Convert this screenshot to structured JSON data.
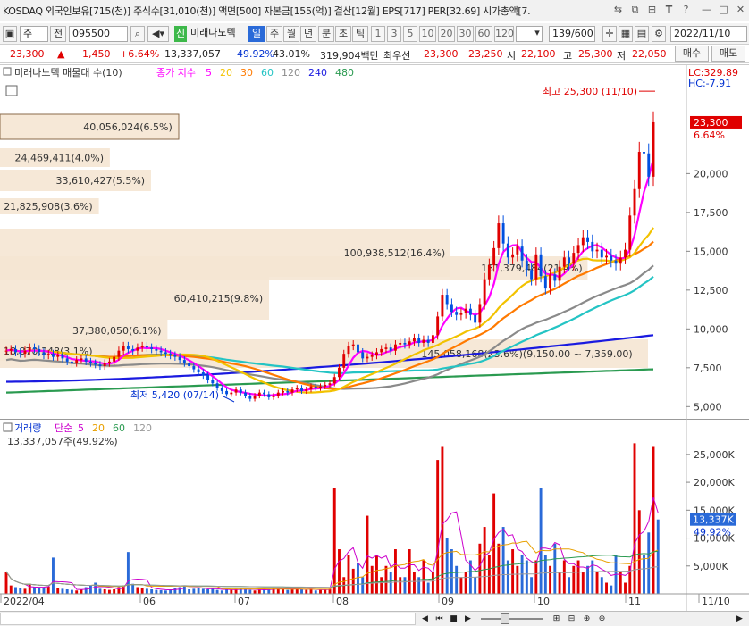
{
  "title_bar": {
    "text": "KOSDAQ 외국인보유[715(천)] 주식수[31,010(천)] 액면[500] 자본금[155(억)] 결산[12월] EPS[717] PER[32.69] 시가총액[7.",
    "icons": [
      "link-icon",
      "copy-icon",
      "pin-icon",
      "font-icon",
      "settings-icon",
      "help-icon",
      "minimize-icon",
      "maximize-icon",
      "close-icon"
    ],
    "glyphs": [
      "⇆",
      "⧉",
      "⊞",
      "T",
      "⚙",
      "?",
      "—",
      "□",
      "✕"
    ]
  },
  "toolbar": {
    "mode_select": "주",
    "jeon_label": "전",
    "stock_code": "095500",
    "stock_name": "미래나노텍",
    "shin_badge": "신",
    "periods": [
      "일",
      "주",
      "월",
      "년",
      "분",
      "초",
      "틱"
    ],
    "selected_period": "일",
    "intervals": [
      "1",
      "3",
      "5",
      "10",
      "20",
      "30",
      "60",
      "120"
    ],
    "bar_count": "139/600",
    "date": "2022/11/10"
  },
  "quote": {
    "price": "23,300",
    "arrow": "▲",
    "change": "1,450",
    "change_pct": "+6.64%",
    "volume": "13,337,057",
    "vol_ratio": "49.92%",
    "foreign_pct": "43.01%",
    "trade_value": "319,904백만",
    "limit_label": "최우선",
    "ask": "23,300",
    "bid": "23,250",
    "open_label": "시",
    "open": "22,100",
    "high_label": "고",
    "high": "25,300",
    "low_label": "저",
    "low": "22,050",
    "buy_button": "매수",
    "sell_button": "매도"
  },
  "price_panel": {
    "legend_name": "미래나노텍 매물대 수(10)",
    "ma_label": "종가 지수",
    "ma_periods": [
      "5",
      "20",
      "30",
      "60",
      "120",
      "240",
      "480"
    ],
    "ma_colors": [
      "#ff00ff",
      "#f2c200",
      "#ff7a00",
      "#24c4c4",
      "#8a8a8a",
      "#1a1ae0",
      "#2a9a50"
    ],
    "lc_label": "LC:329.89",
    "hc_label": "HC:-7.91",
    "current_price_tag": "23,300",
    "current_pct": "6.64%",
    "y_ticks": [
      "20,000",
      "17,500",
      "15,000",
      "12,500",
      "10,000",
      "7,500",
      "5,000"
    ],
    "max_label": "최고 25,300 (11/10)",
    "min_label": "최저 5,420 (07/14)",
    "volume_profile": [
      "40,056,024(6.5%)",
      "24,469,411(4.0%)",
      "33,610,427(5.5%)",
      "21,825,908(3.6%)",
      "100,938,512(16.4%)",
      "60,410,215(9.8%)",
      "37,380,050(6.1%)",
      "18,870,348(3.1%)",
      "131,379,484(21.4%)",
      "145,058,168(23.6%)(9,150.00 ~ 7,359.00)"
    ],
    "volume_profile_pct": [
      6.5,
      4.0,
      5.5,
      3.6,
      16.4,
      9.8,
      6.1,
      3.1,
      21.4,
      23.6
    ]
  },
  "volume_panel": {
    "label": "거래량",
    "ma_label": "단순",
    "ma_periods": [
      "5",
      "20",
      "60",
      "120"
    ],
    "ma_colors": [
      "#cc00cc",
      "#e8a000",
      "#2a9a50",
      "#9a9a9a"
    ],
    "info": "13,337,057주(49.92%)",
    "current_tag": "13,337K",
    "current_pct": "49.92%",
    "y_ticks": [
      "25,000K",
      "20,000K",
      "15,000K",
      "10,000K",
      "5,000K"
    ]
  },
  "x_axis": {
    "labels": [
      "2022/04",
      "06",
      "07",
      "08",
      "09",
      "10",
      "11",
      "11/10"
    ]
  },
  "bottom_bar": {
    "buttons": [
      "◀",
      "⏮",
      "■",
      "▶",
      "▷",
      "⊞",
      "⊟",
      "⊕",
      "⊖",
      "▶"
    ]
  },
  "chart_data": {
    "type": "candlestick",
    "period": "daily",
    "x_range": [
      "2022-04",
      "2022-11-10"
    ],
    "y_range": [
      4500,
      26000
    ],
    "close_series": [
      8600,
      8700,
      8500,
      8400,
      8600,
      8800,
      8700,
      8500,
      8300,
      8400,
      8200,
      8300,
      8100,
      7900,
      7800,
      8000,
      8100,
      7900,
      7800,
      7700,
      7600,
      7800,
      7900,
      8200,
      8600,
      8900,
      8700,
      8600,
      8800,
      8900,
      8800,
      8700,
      8600,
      8500,
      8400,
      8300,
      8200,
      8000,
      7800,
      7600,
      7400,
      7200,
      7000,
      6700,
      6500,
      6200,
      6000,
      5800,
      5900,
      6100,
      5900,
      5700,
      5500,
      5700,
      5900,
      5800,
      5600,
      5700,
      5900,
      6000,
      5900,
      6100,
      6200,
      6000,
      6100,
      6300,
      6200,
      6300,
      6400,
      6500,
      6900,
      7500,
      8400,
      8900,
      9000,
      8500,
      8100,
      8200,
      8300,
      8500,
      8700,
      8800,
      8600,
      9000,
      9100,
      9000,
      9200,
      9400,
      9100,
      9300,
      9100,
      9600,
      10800,
      12200,
      11600,
      11100,
      10900,
      11000,
      11300,
      10900,
      10400,
      11600,
      13200,
      14100,
      15200,
      16800,
      15500,
      14600,
      14800,
      15300,
      14400,
      13800,
      13200,
      14800,
      13400,
      12600,
      13500,
      13100,
      14000,
      14600,
      14200,
      14900,
      15400,
      15900,
      15600,
      15000,
      15100,
      14600,
      14700,
      14400,
      14200,
      14600,
      15100,
      17300,
      19000,
      21400,
      21300,
      19800,
      23300
    ],
    "high": 25300,
    "low": 5420,
    "volume_series_k": [
      4000,
      1500,
      1200,
      1000,
      900,
      1800,
      1200,
      1000,
      1100,
      1300,
      6500,
      1000,
      900,
      800,
      700,
      600,
      800,
      1200,
      1500,
      2000,
      900,
      800,
      700,
      800,
      1200,
      1500,
      7500,
      1800,
      1200,
      1000,
      900,
      800,
      700,
      650,
      600,
      800,
      1000,
      1200,
      1500,
      800,
      900,
      1100,
      900,
      800,
      1000,
      700,
      600,
      800,
      700,
      900,
      1000,
      800,
      700,
      600,
      700,
      800,
      900,
      1000,
      1100,
      800,
      700,
      900,
      1000,
      800,
      700,
      900,
      600,
      700,
      800,
      900,
      19000,
      8000,
      3000,
      7000,
      4500,
      5500,
      3000,
      14000,
      5000,
      7000,
      3000,
      5000,
      4000,
      8000,
      3000,
      3000,
      8000,
      4000,
      3000,
      6000,
      2000,
      4000,
      24000,
      26500,
      10000,
      8000,
      5000,
      3000,
      4000,
      6000,
      3000,
      9000,
      12000,
      7000,
      18000,
      9000,
      12000,
      6000,
      8000,
      5000,
      7000,
      6000,
      3000,
      6000,
      19000,
      7000,
      5000,
      9000,
      4000,
      6000,
      3000,
      5000,
      6000,
      4000,
      5000,
      6000,
      4000,
      3000,
      2000,
      1500,
      7000,
      4000,
      2000,
      5000,
      27000,
      15000,
      7000,
      11000,
      26500,
      13337
    ]
  }
}
